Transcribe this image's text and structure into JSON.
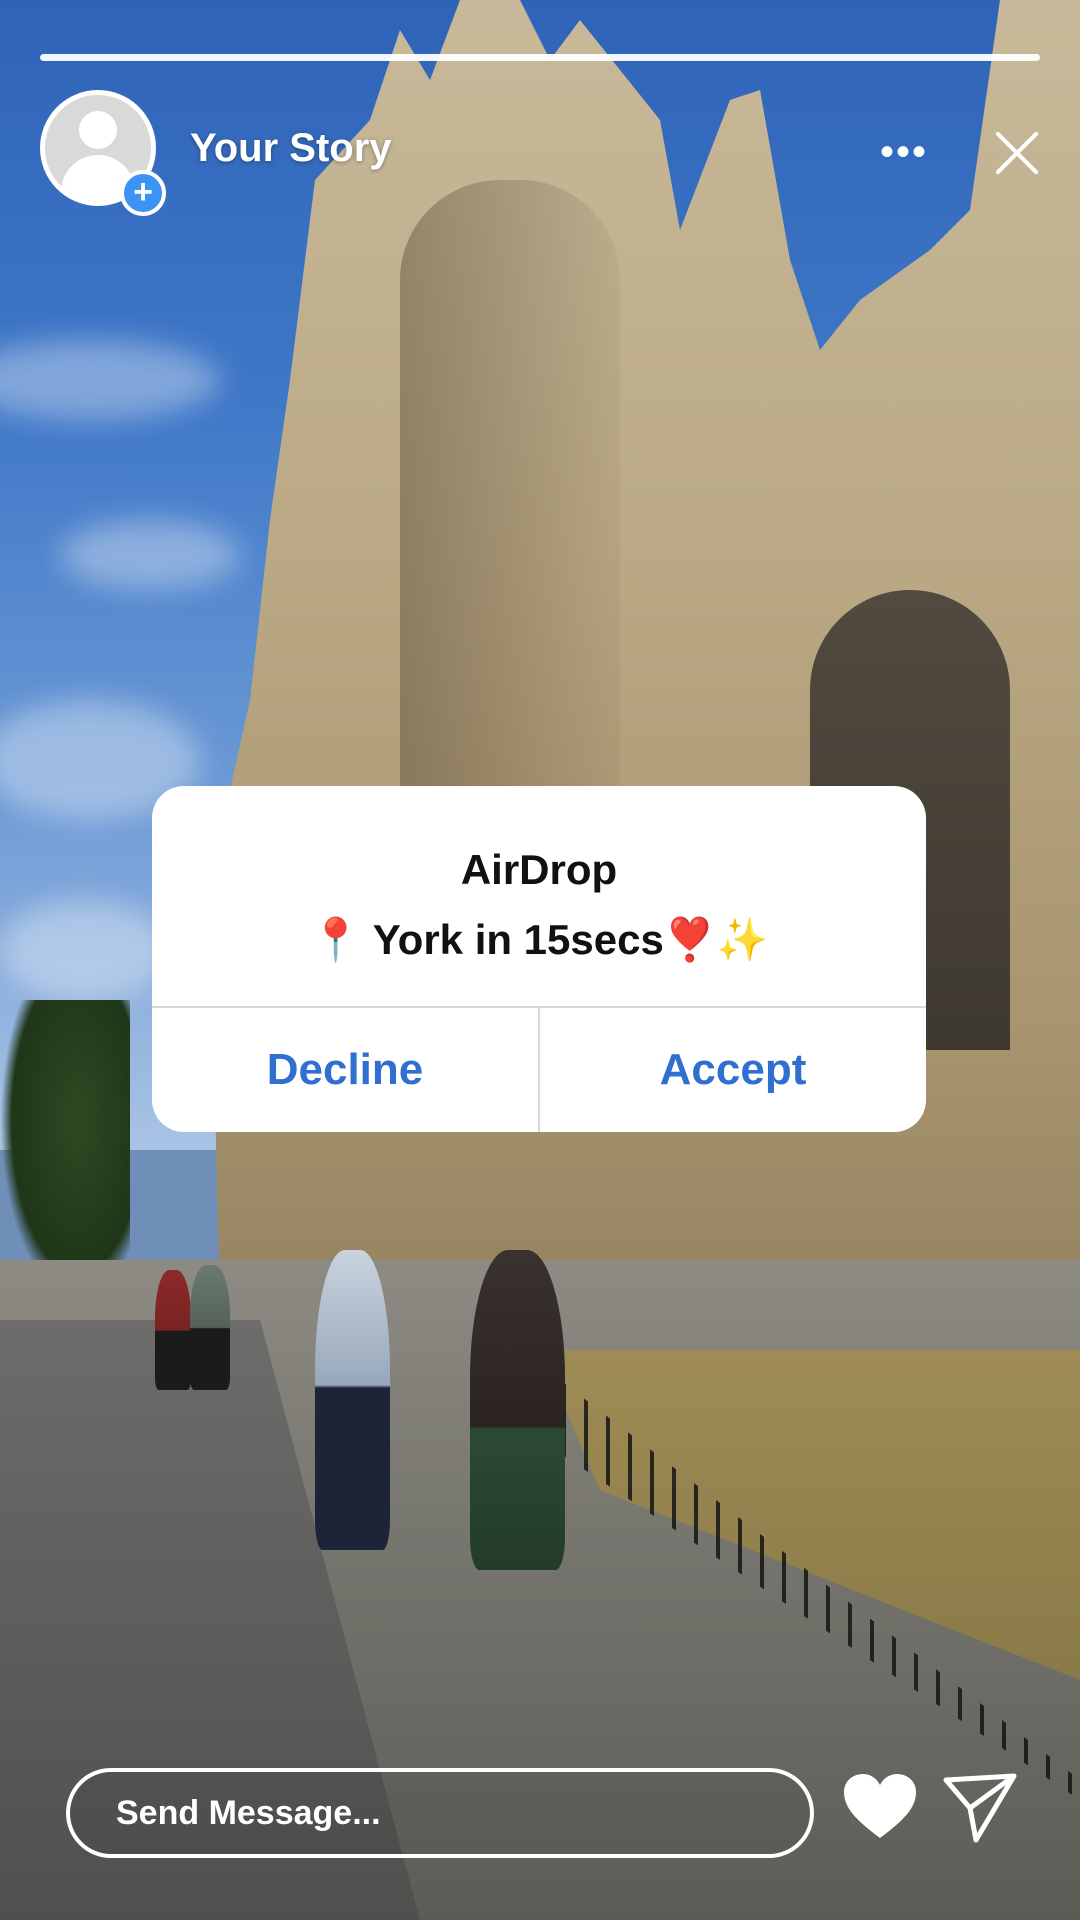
{
  "story": {
    "title": "Your Story",
    "avatar_icon": "person-placeholder-icon",
    "add_badge": "+",
    "more_icon": "•••",
    "close_icon": "close-icon"
  },
  "alert": {
    "title": "AirDrop",
    "message": "📍 York in 15secs❣️✨",
    "decline_label": "Decline",
    "accept_label": "Accept",
    "accent_color": "#2f6fd0"
  },
  "reply": {
    "placeholder": "Send Message...",
    "like_icon": "heart-icon",
    "send_icon": "paper-plane-icon"
  }
}
